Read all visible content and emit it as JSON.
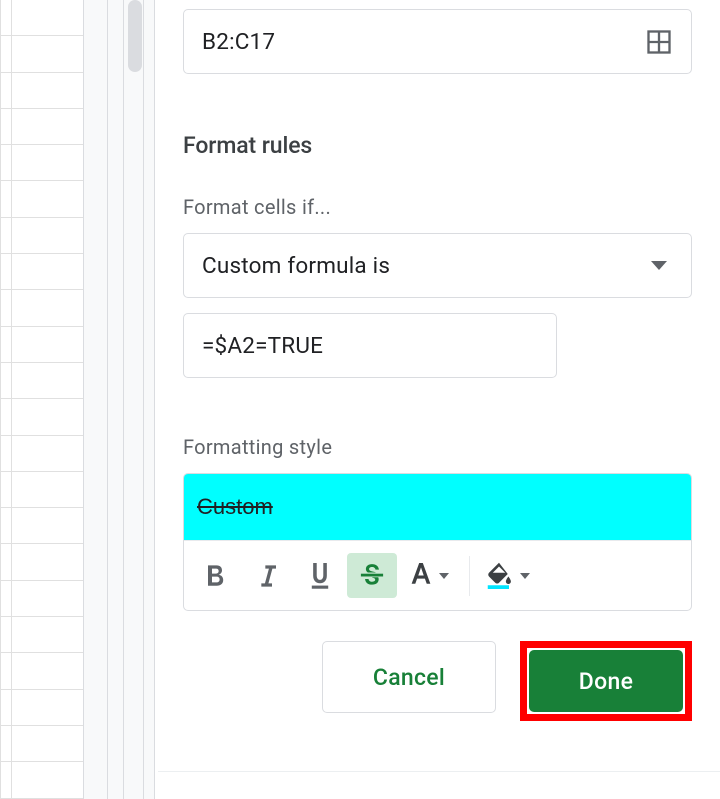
{
  "range": {
    "value": "B2:C17"
  },
  "section_title": "Format rules",
  "format_cells_if_label": "Format cells if...",
  "condition": {
    "selected": "Custom formula is"
  },
  "formula": {
    "value": "=$A2=TRUE"
  },
  "formatting_style_label": "Formatting style",
  "style_preview": {
    "text": "Custom",
    "bg": "#00FFFF",
    "color": "#202124",
    "strikethrough": true
  },
  "toolbar": {
    "bold_active": false,
    "italic_active": false,
    "underline_active": false,
    "strike_active": true,
    "fill_underline_color": "#00E5FF"
  },
  "footer": {
    "cancel_label": "Cancel",
    "done_label": "Done"
  },
  "colors": {
    "google_green": "#188038",
    "highlight_box_red": "#ff0000",
    "icon_gray": "#5f6368",
    "icon_green": "#188038"
  }
}
